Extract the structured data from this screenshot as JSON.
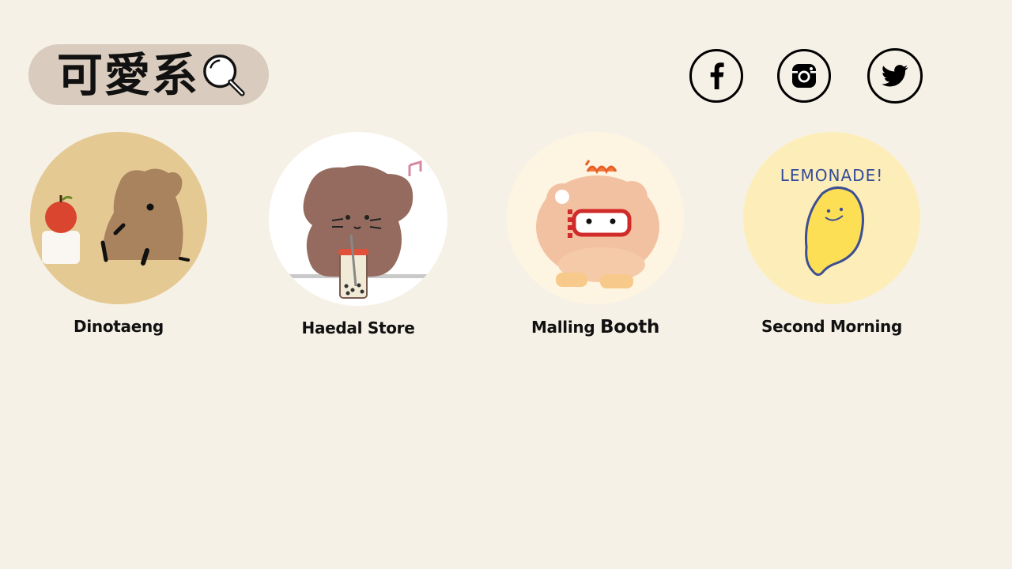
{
  "search": {
    "title": "可愛系",
    "icon": "magnifier-icon",
    "pill_color": "#d9cbbd"
  },
  "social": [
    {
      "name": "facebook",
      "icon": "facebook-icon"
    },
    {
      "name": "instagram",
      "icon": "instagram-icon"
    },
    {
      "name": "twitter",
      "icon": "twitter-icon"
    }
  ],
  "stores": [
    {
      "name": "Dinotaeng",
      "image": "quokka-apple-image"
    },
    {
      "name": "Haedal Store",
      "image": "bear-bubble-tea-image"
    },
    {
      "name_part1": "Malling",
      "name_part2": "Booth",
      "image": "bear-snorkel-image"
    },
    {
      "name": "Second Morning",
      "image": "lemonade-image",
      "image_text": "LEMONADE!"
    }
  ],
  "colors": {
    "background": "#f6f1e6",
    "text": "#111111"
  }
}
